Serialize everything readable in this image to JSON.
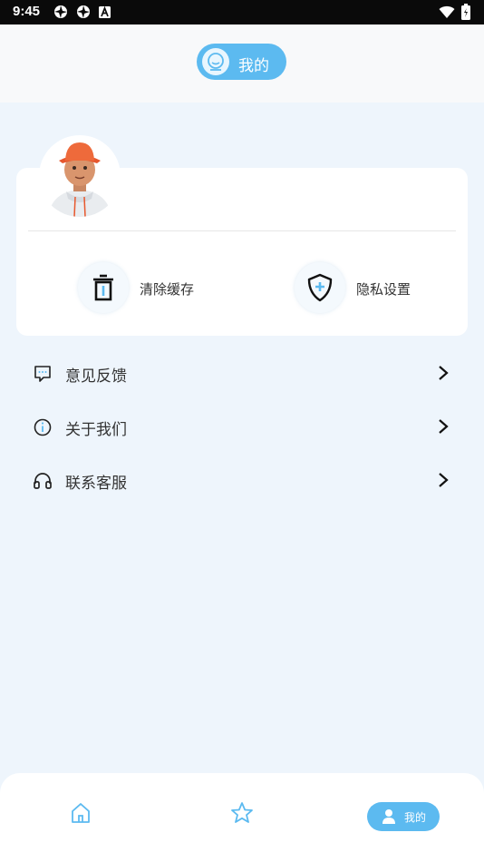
{
  "status_bar": {
    "time": "9:45",
    "left_icons": [
      "aperture-icon",
      "aperture-icon",
      "text-a-icon"
    ],
    "right_icons": [
      "wifi-icon",
      "battery-icon"
    ]
  },
  "header": {
    "title": "我的",
    "title_icon": "face-icon",
    "accent_color": "#5cbaf0"
  },
  "profile": {
    "avatar": "avatar-3d-character"
  },
  "quick_actions": [
    {
      "label": "清除缓存",
      "icon": "trash-icon"
    },
    {
      "label": "隐私设置",
      "icon": "shield-plus-icon"
    }
  ],
  "menu": [
    {
      "label": "意见反馈",
      "icon": "message-icon"
    },
    {
      "label": "关于我们",
      "icon": "info-icon"
    },
    {
      "label": "联系客服",
      "icon": "headset-icon"
    }
  ],
  "tab_bar": {
    "tabs": [
      {
        "icon": "home-icon",
        "label": ""
      },
      {
        "icon": "star-icon",
        "label": ""
      },
      {
        "icon": "user-icon",
        "label": "我的",
        "active": true
      }
    ]
  }
}
